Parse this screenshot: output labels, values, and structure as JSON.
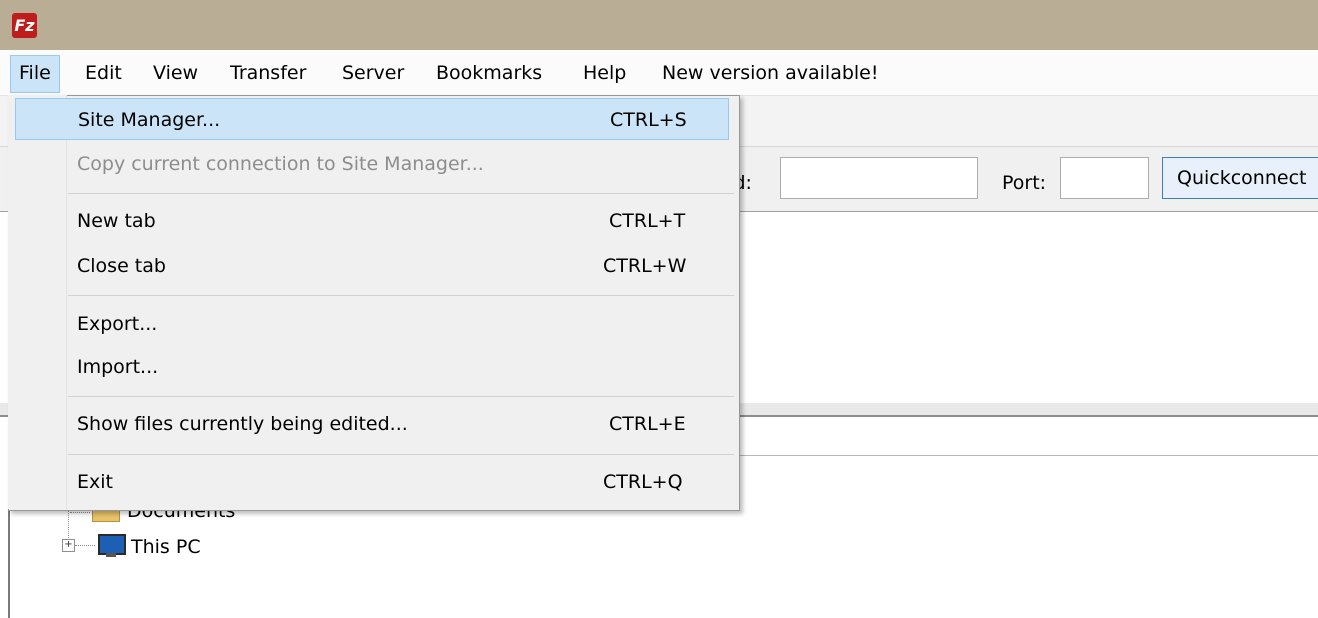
{
  "app": {
    "logo_text": "Fz",
    "logo_color": "#bf1c1c",
    "title_bar_color": "#b9ad96"
  },
  "menubar": {
    "items": [
      {
        "label": "File"
      },
      {
        "label": "Edit"
      },
      {
        "label": "View"
      },
      {
        "label": "Transfer"
      },
      {
        "label": "Server"
      },
      {
        "label": "Bookmarks"
      },
      {
        "label": "Help"
      },
      {
        "label": "New version available!"
      }
    ]
  },
  "file_menu": {
    "items": [
      {
        "label": "Site Manager...",
        "shortcut": "CTRL+S",
        "state": "highlighted"
      },
      {
        "label": "Copy current connection to Site Manager...",
        "shortcut": "",
        "state": "disabled"
      },
      {
        "label": "New tab",
        "shortcut": "CTRL+T"
      },
      {
        "label": "Close tab",
        "shortcut": "CTRL+W"
      },
      {
        "label": "Export...",
        "shortcut": ""
      },
      {
        "label": "Import...",
        "shortcut": ""
      },
      {
        "label": "Show files currently being edited...",
        "shortcut": "CTRL+E"
      },
      {
        "label": "Exit",
        "shortcut": "CTRL+Q"
      }
    ]
  },
  "quickconnect": {
    "password_label": "rd:",
    "password_value": "",
    "port_label": "Port:",
    "port_value": "",
    "button_label": "Quickconnect"
  },
  "local_tree": {
    "items": [
      {
        "label": "Documents",
        "icon": "folder-icon"
      },
      {
        "label": "This PC",
        "icon": "computer-icon"
      }
    ]
  }
}
